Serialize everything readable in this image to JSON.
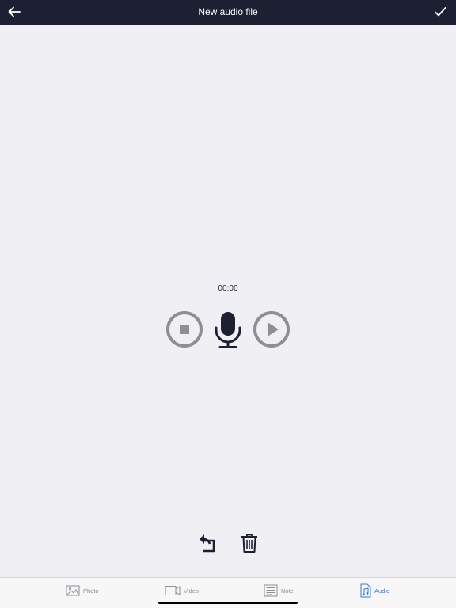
{
  "header": {
    "title": "New audio file",
    "back_icon": "arrow-left-icon",
    "done_icon": "checkmark-icon"
  },
  "recorder": {
    "elapsed": "00:00",
    "stop_icon": "stop-circle-icon",
    "mic_icon": "microphone-icon",
    "play_icon": "play-circle-icon"
  },
  "actions": {
    "undo_icon": "undo-icon",
    "trash_icon": "trash-icon"
  },
  "tabs": [
    {
      "label": "Photo",
      "icon": "photo-icon",
      "active": false
    },
    {
      "label": "Video",
      "icon": "video-icon",
      "active": false
    },
    {
      "label": "Note",
      "icon": "note-icon",
      "active": false
    },
    {
      "label": "Audio",
      "icon": "audio-file-icon",
      "active": true
    }
  ],
  "colors": {
    "navbar": "#1c2032",
    "background": "#efeff4",
    "control_gray": "#8e8e93",
    "accent": "#2f7de1"
  }
}
